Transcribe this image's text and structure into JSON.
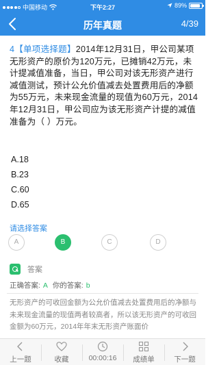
{
  "status_bar": {
    "carrier": "中国移动",
    "time": "下午2:27",
    "battery_text": "89%",
    "battery_level": 0.89,
    "icons": [
      "signal-dots-icon",
      "wifi-icon",
      "location-icon",
      "battery-icon"
    ]
  },
  "nav": {
    "title": "历年真题",
    "progress": "4/39",
    "back_icon": "chevron-left-icon"
  },
  "question": {
    "number": "4",
    "type": "【单项选择题】",
    "text": "2014年12月31日，甲公司某项无形资产的原价为120万元，已摊销42万元，未计提减值准备，当日，甲公司对该无形资产进行减值测试，预计公允价值减去处置费用后的净额为55万元，未来现金流量的现值为60万元，2014年12月31日，甲公司应为该无形资产计提的减值准备为（ ）万元。"
  },
  "options": [
    {
      "label": "A.18"
    },
    {
      "label": "B.23"
    },
    {
      "label": "C.60"
    },
    {
      "label": "D.65"
    }
  ],
  "choice_prompt": "请选择答案",
  "choices": [
    {
      "letter": "A",
      "selected": false
    },
    {
      "letter": "B",
      "selected": true
    },
    {
      "letter": "C",
      "selected": false
    },
    {
      "letter": "D",
      "selected": false
    }
  ],
  "answer": {
    "heading": "答案",
    "correct_label": "正确答案:",
    "correct_value": "A",
    "mine_label": "你的答案:",
    "mine_value": "b"
  },
  "explanation": "无形资产的可收回金额为公允价值减去处置费用后的净额与未来现金流量的现值两者较高者，所以该无形资产的可收回金额为60万元，2014年年末无形资产账面价",
  "tabbar": [
    {
      "label": "上一题",
      "icon": "arrow-left-icon"
    },
    {
      "label": "收藏",
      "icon": "heart-icon"
    },
    {
      "label": "00:00:16",
      "icon": "clock-icon"
    },
    {
      "label": "成绩单",
      "icon": "grid-icon"
    },
    {
      "label": "下一题",
      "icon": "arrow-right-icon"
    }
  ],
  "colors": {
    "primary": "#2f8ce4",
    "success": "#2bbf6f",
    "muted": "#888888"
  }
}
